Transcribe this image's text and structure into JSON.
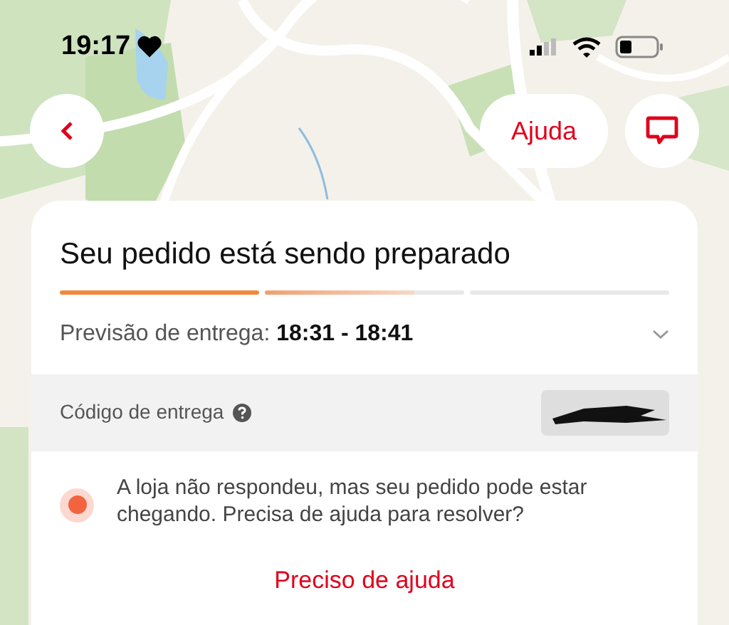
{
  "status_bar": {
    "time": "19:17"
  },
  "top_buttons": {
    "help": "Ajuda"
  },
  "order": {
    "title": "Seu pedido está sendo preparado",
    "progress": [
      {
        "level": 1
      },
      {
        "level": 0.75
      },
      {
        "level": 0
      }
    ],
    "eta_label": "Previsão de entrega:",
    "eta_value": "18:31 - 18:41",
    "expanded": false,
    "code_label": "Código de entrega",
    "notice": "A loja não respondeu, mas seu pedido pode estar chegando. Precisa de ajuda para resolver?",
    "help_button": "Preciso de ajuda"
  }
}
